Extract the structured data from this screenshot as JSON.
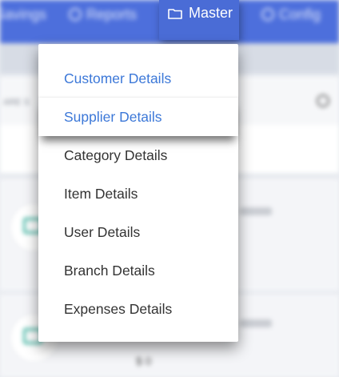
{
  "topnav": {
    "savings_label": "Savings",
    "reports_label": "Reports",
    "master_label": "Master",
    "config_label": "Config",
    "accent_color": "#4d6fdc"
  },
  "panel": {
    "label": "ARE S"
  },
  "cards": {
    "money": "$ 0"
  },
  "dropdown": {
    "items": [
      {
        "label": "Customer Details"
      },
      {
        "label": "Supplier Details"
      },
      {
        "label": "Category Details"
      },
      {
        "label": "Item Details"
      },
      {
        "label": "User Details"
      },
      {
        "label": "Branch Details"
      },
      {
        "label": "Expenses Details"
      }
    ],
    "link_color": "#3c78d8"
  }
}
